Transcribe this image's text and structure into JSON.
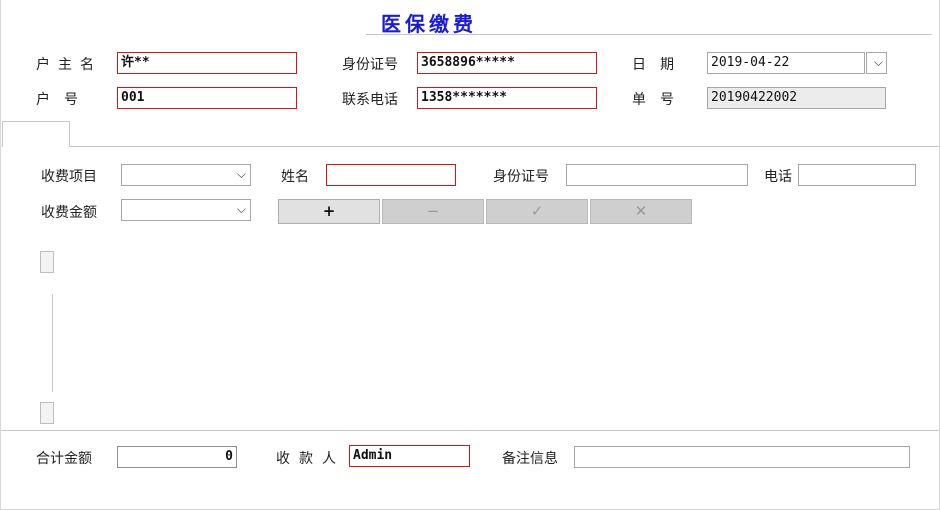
{
  "window": {
    "title": "医保缴费"
  },
  "header": {
    "owner_label": "户主名",
    "owner_value": "许**",
    "id_label": "身份证号",
    "id_value": "3658896*****",
    "date_label": "日　期",
    "date_value": "2019-04-22",
    "hukou_label": "户　号",
    "hukou_value": "001",
    "phone_label": "联系电话",
    "phone_value": "1358*******",
    "order_label": "单　号",
    "order_value": "20190422002"
  },
  "detail": {
    "item_label": "收费项目",
    "item_value": "",
    "name_label": "姓名",
    "name_value": "",
    "id_label": "身份证号",
    "id_value": "",
    "phone_label": "电话",
    "phone_value": "",
    "amount_label": "收费金额",
    "amount_value": ""
  },
  "toolbar": {
    "add_symbol": "+",
    "remove_symbol": "−",
    "confirm_symbol": "✓",
    "cancel_symbol": "✕"
  },
  "footer": {
    "total_label": "合计金额",
    "total_value": "0",
    "payee_label": "收款人",
    "payee_value": "Admin",
    "remark_label": "备注信息",
    "remark_value": ""
  },
  "icons": {
    "dropdown": "chevron-down-icon"
  },
  "colors": {
    "title": "#1a1adb",
    "required_border": "#d01818",
    "readonly_bg": "#ececec"
  }
}
